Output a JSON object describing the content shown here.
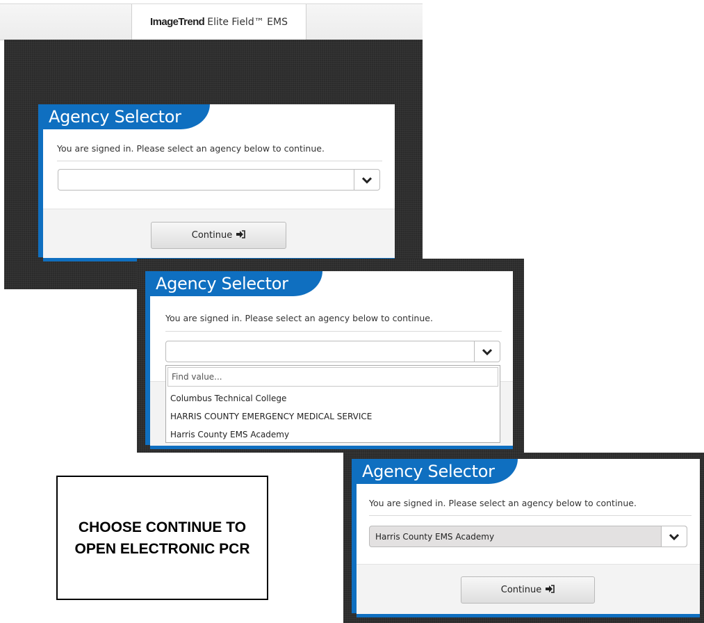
{
  "app": {
    "brand_logo": "ImageTrend",
    "brand_name": "Elite Field™ EMS"
  },
  "panel1": {
    "title": "Agency Selector",
    "message": "You are signed in. Please select an agency below to continue.",
    "selected_value": "",
    "continue_label": "Continue"
  },
  "panel2": {
    "title": "Agency Selector",
    "message": "You are signed in. Please select an agency below to continue.",
    "selected_value": "",
    "find_placeholder": "Find value...",
    "options": [
      "Columbus Technical College",
      "HARRIS COUNTY EMERGENCY MEDICAL SERVICE",
      "Harris County EMS Academy"
    ]
  },
  "panel3": {
    "title": "Agency Selector",
    "message": "You are signed in. Please select an agency below to continue.",
    "selected_value": "Harris County EMS Academy",
    "continue_label": "Continue"
  },
  "callout": {
    "text": "CHOOSE CONTINUE TO OPEN ELECTRONIC PCR"
  },
  "icons": {
    "caret": "chevron-down-icon",
    "continue": "sign-in-icon"
  },
  "colors": {
    "accent": "#0f6fc0",
    "background_dark": "#2b2b2b"
  }
}
